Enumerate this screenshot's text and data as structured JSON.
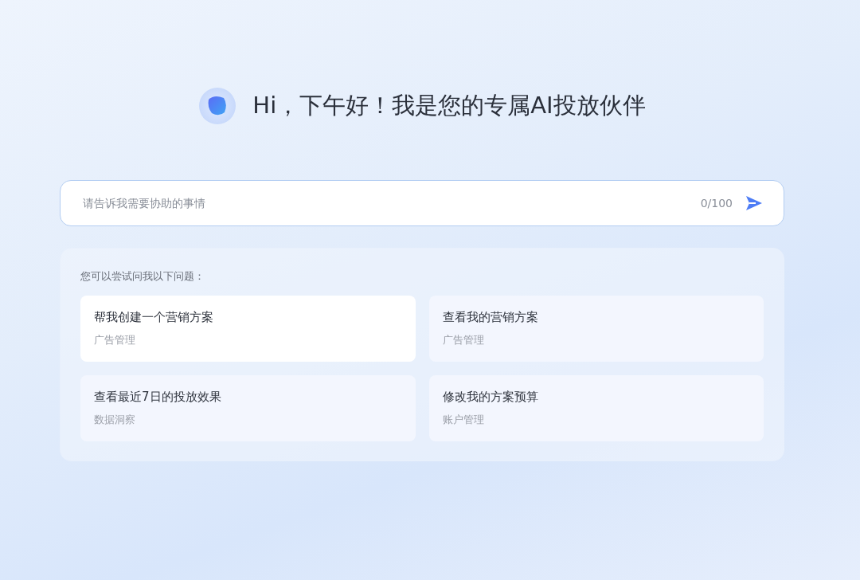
{
  "greeting": "Hi，下午好！我是您的专属AI投放伙伴",
  "input": {
    "placeholder": "请告诉我需要协助的事情",
    "counter": "0/100"
  },
  "suggestions": {
    "heading": "您可以尝试问我以下问题：",
    "items": [
      {
        "title": "帮我创建一个营销方案",
        "category": "广告管理",
        "selected": true
      },
      {
        "title": "查看我的营销方案",
        "category": "广告管理",
        "selected": false
      },
      {
        "title": "查看最近7日的投放效果",
        "category": "数据洞察",
        "selected": false
      },
      {
        "title": "修改我的方案预算",
        "category": "账户管理",
        "selected": false
      }
    ]
  }
}
